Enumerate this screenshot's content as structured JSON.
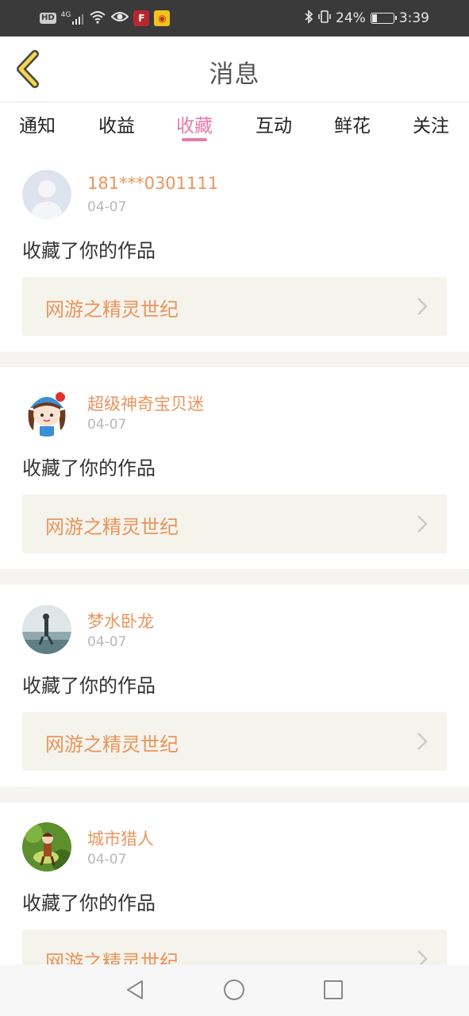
{
  "status_bar": {
    "left_icons": [
      "hd-icon",
      "4g-signal-icon",
      "wifi-icon",
      "eye-icon",
      "app-notification-icon",
      "weibo-icon"
    ],
    "hd_label": "HD",
    "network_label": "4G",
    "battery_percent": "24%",
    "battery_level": 0.24,
    "time": "3:39",
    "right_icons": [
      "bluetooth-icon",
      "vibrate-icon",
      "battery-icon"
    ]
  },
  "header": {
    "title": "消息",
    "back_icon": "back-chevron-icon",
    "back_color": "#f2d64b"
  },
  "tabs": {
    "items": [
      "通知",
      "收益",
      "收藏",
      "互动",
      "鲜花",
      "关注"
    ],
    "active_index": 2,
    "active_color": "#e77aa9"
  },
  "feed": {
    "items": [
      {
        "username": "181***0301111",
        "date": "04-07",
        "action": "收藏了你的作品",
        "work_title": "网游之精灵世纪",
        "avatar": "default-avatar"
      },
      {
        "username": "超级神奇宝贝迷",
        "date": "04-07",
        "action": "收藏了你的作品",
        "work_title": "网游之精灵世纪",
        "avatar": "cartoon-girl-avatar"
      },
      {
        "username": "梦水卧龙",
        "date": "04-07",
        "action": "收藏了你的作品",
        "work_title": "网游之精灵世纪",
        "avatar": "beach-photo-avatar"
      },
      {
        "username": "城市猎人",
        "date": "04-07",
        "action": "收藏了你的作品",
        "work_title": "网游之精灵世纪",
        "avatar": "game-character-avatar"
      }
    ],
    "accent_color": "#e9955d"
  },
  "nav_bar": {
    "buttons": [
      "back-triangle-icon",
      "home-circle-icon",
      "recents-square-icon"
    ]
  }
}
